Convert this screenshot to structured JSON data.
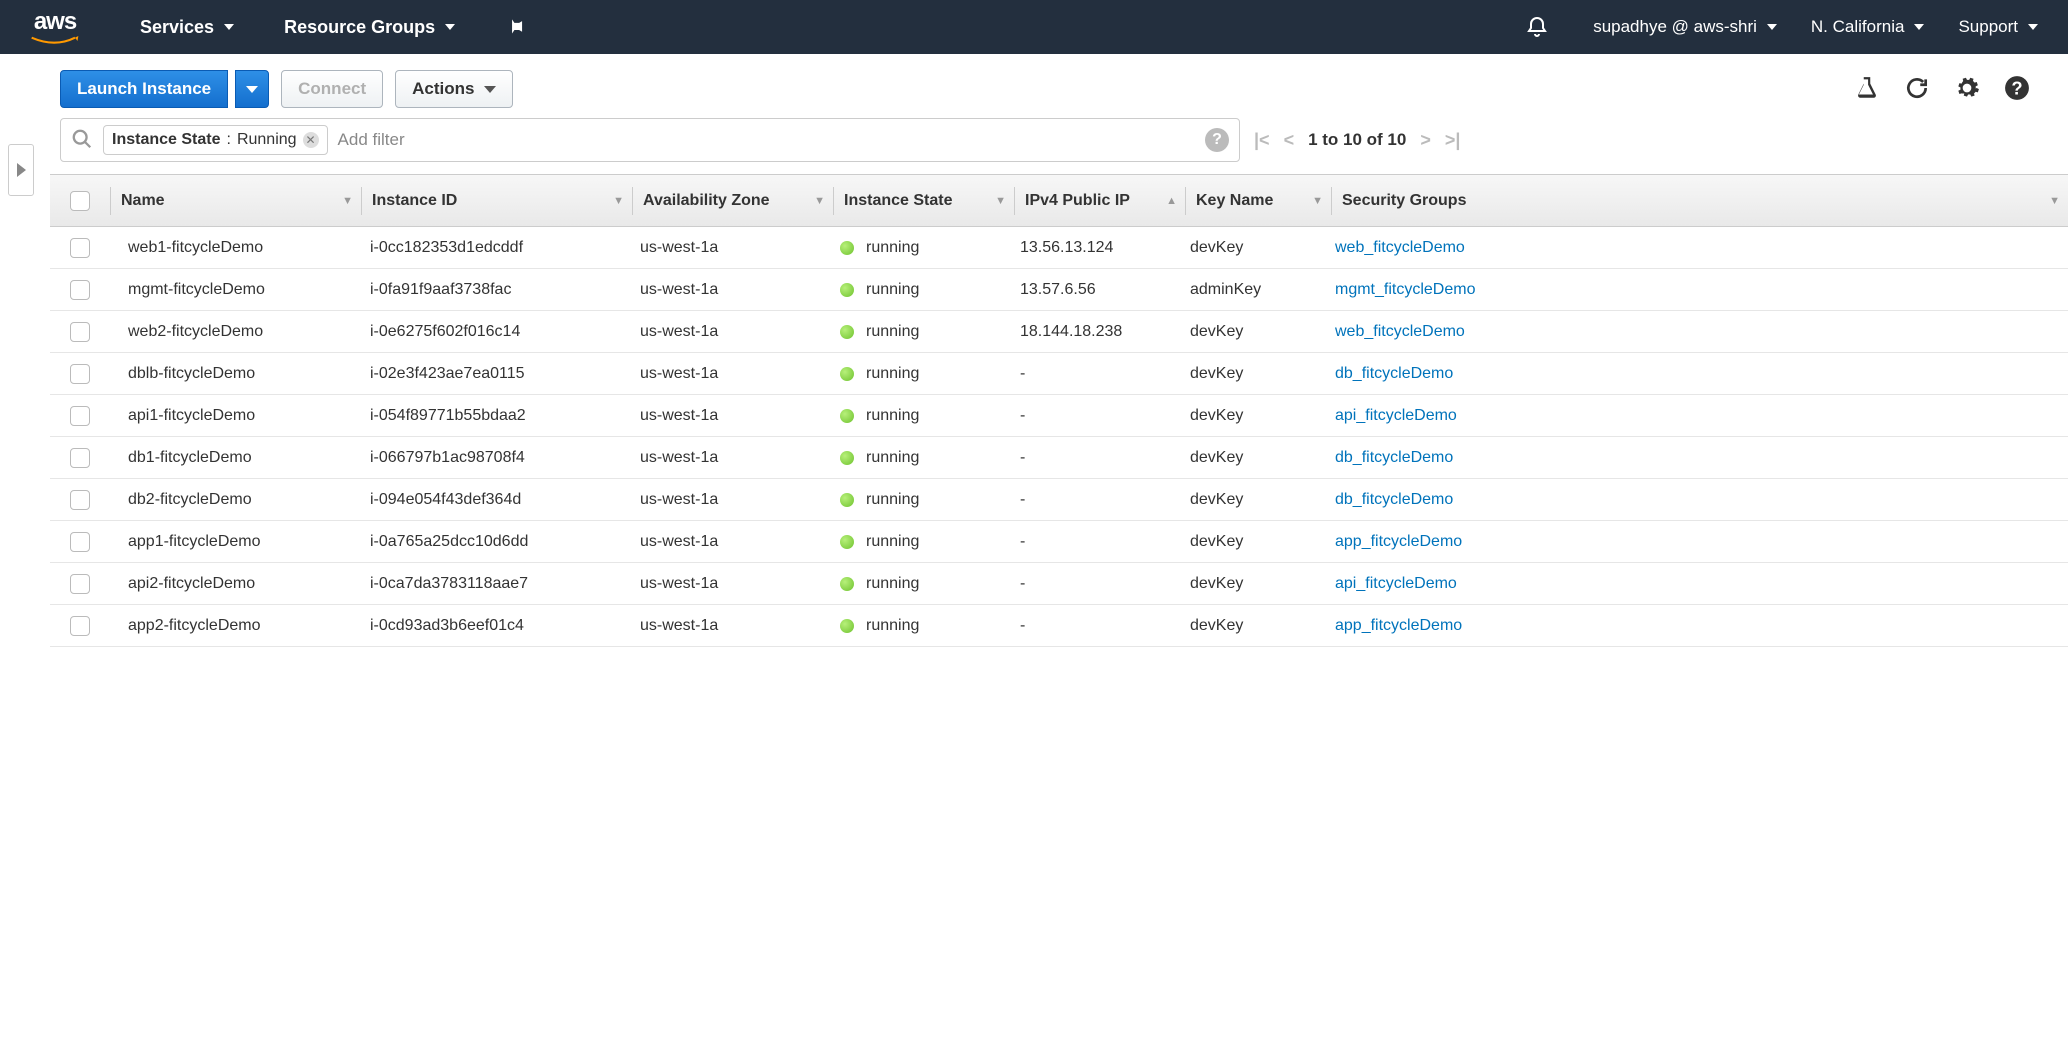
{
  "topnav": {
    "services": "Services",
    "resource_groups": "Resource Groups",
    "user": "supadhye @ aws-shri",
    "region": "N. California",
    "support": "Support"
  },
  "toolbar": {
    "launch": "Launch Instance",
    "connect": "Connect",
    "actions": "Actions"
  },
  "filter": {
    "tag_label": "Instance State",
    "tag_value": "Running",
    "placeholder": "Add filter",
    "pager": "1 to 10 of 10"
  },
  "columns": {
    "name": "Name",
    "instance_id": "Instance ID",
    "az": "Availability Zone",
    "state": "Instance State",
    "ip": "IPv4 Public IP",
    "key": "Key Name",
    "sg": "Security Groups"
  },
  "rows": [
    {
      "name": "web1-fitcycleDemo",
      "iid": "i-0cc182353d1edcddf",
      "az": "us-west-1a",
      "state": "running",
      "ip": "13.56.13.124",
      "key": "devKey",
      "sg": "web_fitcycleDemo"
    },
    {
      "name": "mgmt-fitcycleDemo",
      "iid": "i-0fa91f9aaf3738fac",
      "az": "us-west-1a",
      "state": "running",
      "ip": "13.57.6.56",
      "key": "adminKey",
      "sg": "mgmt_fitcycleDemo"
    },
    {
      "name": "web2-fitcycleDemo",
      "iid": "i-0e6275f602f016c14",
      "az": "us-west-1a",
      "state": "running",
      "ip": "18.144.18.238",
      "key": "devKey",
      "sg": "web_fitcycleDemo"
    },
    {
      "name": "dblb-fitcycleDemo",
      "iid": "i-02e3f423ae7ea0115",
      "az": "us-west-1a",
      "state": "running",
      "ip": "-",
      "key": "devKey",
      "sg": "db_fitcycleDemo"
    },
    {
      "name": "api1-fitcycleDemo",
      "iid": "i-054f89771b55bdaa2",
      "az": "us-west-1a",
      "state": "running",
      "ip": "-",
      "key": "devKey",
      "sg": "api_fitcycleDemo"
    },
    {
      "name": "db1-fitcycleDemo",
      "iid": "i-066797b1ac98708f4",
      "az": "us-west-1a",
      "state": "running",
      "ip": "-",
      "key": "devKey",
      "sg": "db_fitcycleDemo"
    },
    {
      "name": "db2-fitcycleDemo",
      "iid": "i-094e054f43def364d",
      "az": "us-west-1a",
      "state": "running",
      "ip": "-",
      "key": "devKey",
      "sg": "db_fitcycleDemo"
    },
    {
      "name": "app1-fitcycleDemo",
      "iid": "i-0a765a25dcc10d6dd",
      "az": "us-west-1a",
      "state": "running",
      "ip": "-",
      "key": "devKey",
      "sg": "app_fitcycleDemo"
    },
    {
      "name": "api2-fitcycleDemo",
      "iid": "i-0ca7da3783118aae7",
      "az": "us-west-1a",
      "state": "running",
      "ip": "-",
      "key": "devKey",
      "sg": "api_fitcycleDemo"
    },
    {
      "name": "app2-fitcycleDemo",
      "iid": "i-0cd93ad3b6eef01c4",
      "az": "us-west-1a",
      "state": "running",
      "ip": "-",
      "key": "devKey",
      "sg": "app_fitcycleDemo"
    }
  ]
}
